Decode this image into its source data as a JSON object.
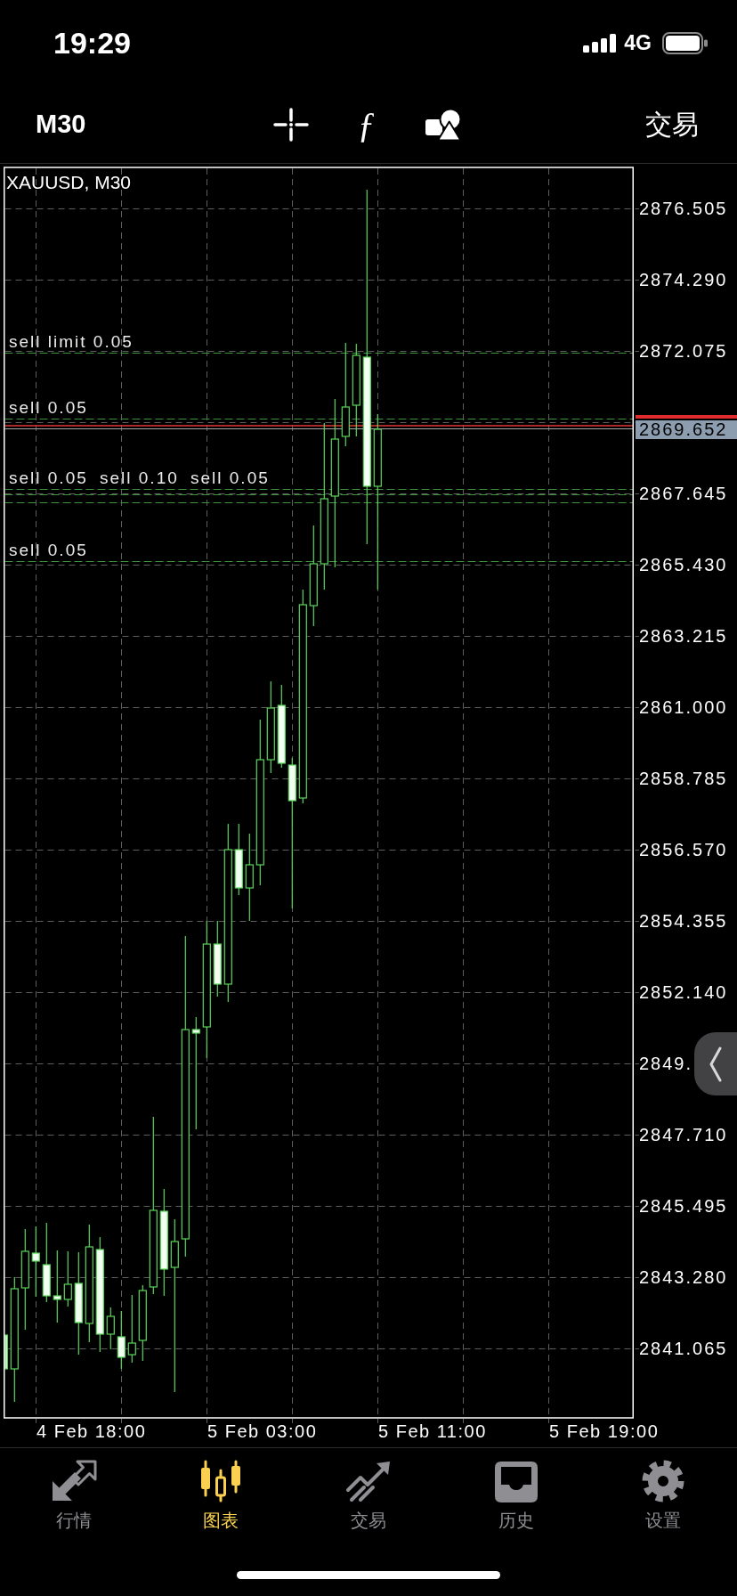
{
  "status_bar": {
    "time": "19:29",
    "network": "4G"
  },
  "toolbar": {
    "timeframe": "M30",
    "indicators_symbol": "ƒ",
    "trade": "交易"
  },
  "chart": {
    "symbol": "XAUUSD, M30",
    "orders": [
      {
        "label": "sell limit 0.05"
      },
      {
        "label": "sell 0.05"
      },
      {
        "label": "sell 0.05"
      },
      {
        "label": "sell 0.10"
      },
      {
        "label": "sell 0.05"
      },
      {
        "label": "sell 0.05"
      }
    ],
    "price_axis": [
      "2876.505",
      "2874.290",
      "2872.075",
      "2867.645",
      "2865.430",
      "2863.215",
      "2861.000",
      "2858.785",
      "2856.570",
      "2854.355",
      "2852.140",
      "2849.",
      "2847.710",
      "2845.495",
      "2843.280",
      "2841.065"
    ],
    "current_price": "2869.652",
    "time_axis": [
      "4 Feb 18:00",
      "5 Feb 03:00",
      "5 Feb 11:00",
      "5 Feb 19:00"
    ]
  },
  "tab_bar": [
    {
      "label": "行情",
      "selected": false
    },
    {
      "label": "图表",
      "selected": true
    },
    {
      "label": "交易",
      "selected": false
    },
    {
      "label": "历史",
      "selected": false
    },
    {
      "label": "设置",
      "selected": false
    }
  ]
}
